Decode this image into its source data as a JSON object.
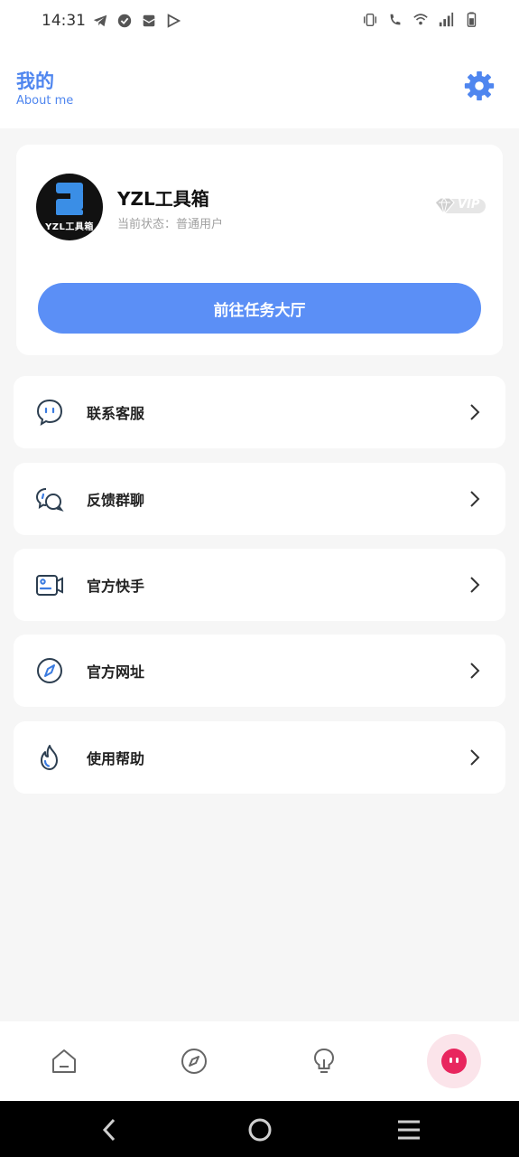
{
  "status_bar": {
    "time": "14:31",
    "icons_left": [
      "telegram-icon",
      "check-circle-icon",
      "mail-icon",
      "play-store-icon"
    ],
    "icons_right": [
      "vibrate-icon",
      "wifi-call-icon",
      "wifi-icon",
      "signal-icon",
      "battery-icon"
    ]
  },
  "header": {
    "title": "我的",
    "subtitle": "About me",
    "settings_icon": "gear-icon",
    "accent": "#4f86ef"
  },
  "profile": {
    "avatar_text": "YZL工具箱",
    "name": "YZL工具箱",
    "status_label": "当前状态：",
    "status_value": "普通用户",
    "badge": "VIP",
    "action_label": "前往任务大厅",
    "action_color": "#5b8ff6"
  },
  "menu": {
    "items": [
      {
        "label": "联系客服",
        "icon": "chat-bubble-icon"
      },
      {
        "label": "反馈群聊",
        "icon": "group-chat-icon"
      },
      {
        "label": "官方快手",
        "icon": "video-camera-icon"
      },
      {
        "label": "官方网址",
        "icon": "compass-icon"
      },
      {
        "label": "使用帮助",
        "icon": "flame-icon"
      }
    ]
  },
  "bottom_nav": {
    "items": [
      {
        "icon": "home-icon",
        "active": false
      },
      {
        "icon": "compass-icon",
        "active": false
      },
      {
        "icon": "lightbulb-icon",
        "active": false
      },
      {
        "icon": "profile-face-icon",
        "active": true
      }
    ],
    "active_color": "#e8265e"
  },
  "system_nav": {
    "items": [
      "back-icon",
      "home-circle-icon",
      "recents-menu-icon"
    ]
  }
}
